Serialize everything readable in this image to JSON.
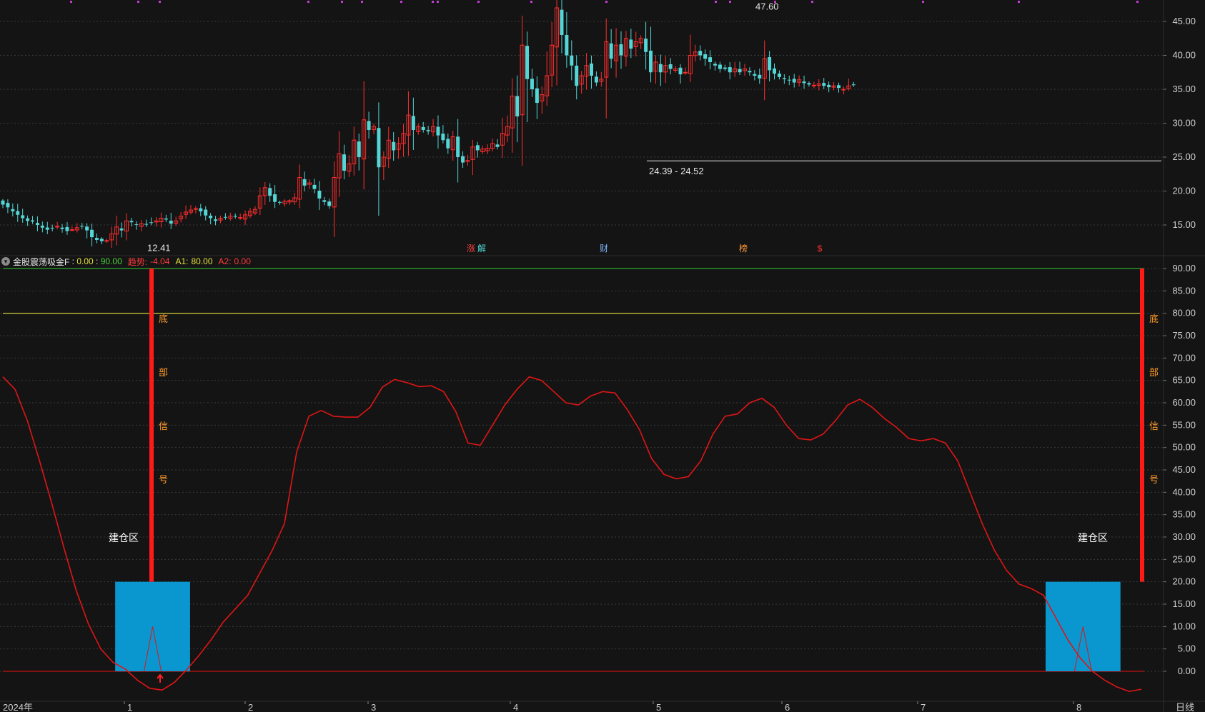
{
  "indicator": {
    "name": "金股震荡吸金F",
    "v0": "0.00",
    "v1": "90.00",
    "trend_label": "趋势:",
    "trend_value": "-4.04",
    "a1_label": "A1:",
    "a1_value": "80.00",
    "a2_label": "A2:",
    "a2_value": "0.00"
  },
  "colors": {
    "bg": "#141414",
    "up": "#ff2d2d",
    "down": "#54d6d6",
    "osc": "#e01515",
    "zone": "#0a97cf",
    "line90": "#2ea82e",
    "line80": "#e6e23c",
    "zero": "#c01010",
    "grid": "#3a3a3a",
    "axis": "#d0d0d0"
  },
  "events": [
    {
      "label": "涨",
      "color": "#ff4040"
    },
    {
      "label": "解",
      "color": "#54d6d6"
    },
    {
      "label": "财",
      "color": "#7fb6ff"
    },
    {
      "label": "榜",
      "color": "#ff9a3a"
    },
    {
      "label": "$",
      "color": "#ff3030"
    }
  ],
  "chart_data": [
    {
      "type": "candlestick",
      "y_ticks": [
        "45.00",
        "40.00",
        "35.00",
        "30.00",
        "25.00",
        "20.00",
        "15.00"
      ],
      "ylim": [
        11.5,
        48.5
      ],
      "annotations": {
        "high": {
          "text": "47.60",
          "value": 47.6
        },
        "low": {
          "text": "12.41",
          "value": 12.41
        },
        "range": {
          "text": "24.39 - 24.52",
          "value": 24.45
        }
      },
      "period": "日线",
      "x_ticks": [
        "2024年",
        "1",
        "2",
        "3",
        "4",
        "5",
        "6",
        "7",
        "8"
      ],
      "close": [
        18.0,
        17.6,
        17.0,
        16.5,
        16.0,
        15.6,
        15.5,
        15.0,
        14.6,
        14.3,
        14.5,
        14.8,
        14.4,
        14.1,
        14.3,
        14.6,
        14.8,
        14.2,
        13.2,
        12.8,
        12.6,
        12.7,
        13.7,
        14.7,
        14.2,
        15.6,
        15.4,
        15.0,
        15.2,
        15.1,
        15.3,
        15.6,
        16.0,
        15.8,
        15.2,
        15.6,
        16.3,
        16.9,
        17.2,
        17.4,
        17.0,
        16.4,
        16.0,
        15.6,
        16.0,
        16.1,
        16.3,
        16.2,
        16.1,
        16.5,
        17.0,
        17.3,
        19.3,
        20.5,
        19.3,
        18.4,
        18.3,
        18.5,
        18.6,
        19.0,
        22.0,
        20.8,
        21.2,
        20.3,
        18.9,
        18.4,
        17.8,
        22.0,
        25.5,
        23.0,
        24.0,
        27.5,
        25.0,
        30.5,
        29.0,
        29.5,
        23.5,
        25.0,
        27.5,
        26.0,
        27.0,
        28.5,
        31.2,
        29.0,
        29.5,
        29.0,
        28.8,
        29.5,
        28.2,
        27.5,
        26.3,
        28.0,
        25.0,
        24.2,
        24.5,
        26.5,
        26.0,
        26.2,
        26.3,
        27.0,
        26.5,
        28.5,
        29.5,
        34.0,
        31.0,
        41.5,
        36.5,
        35.0,
        33.0,
        34.2,
        37.0,
        41.5,
        47.0,
        43.0,
        40.0,
        38.5,
        35.5,
        37.0,
        38.5,
        37.0,
        36.0,
        36.5,
        42.0,
        39.5,
        41.5,
        40.0,
        42.5,
        41.0,
        42.0,
        42.5,
        40.5,
        37.5,
        39.0,
        37.5,
        38.5,
        38.0,
        38.0,
        37.2,
        37.5,
        40.0,
        40.5,
        40.0,
        39.5,
        39.0,
        38.5,
        38.0,
        38.0,
        37.5,
        38.0,
        37.5,
        38.0,
        37.5,
        37.0,
        36.6,
        39.5,
        37.8,
        37.3,
        36.8,
        36.5,
        36.3,
        36.0,
        36.4,
        35.9,
        35.7,
        35.6,
        35.8,
        35.5,
        35.3,
        35.5,
        35.2,
        35.0,
        35.5,
        35.6
      ]
    },
    {
      "type": "line",
      "name": "金股震荡吸金F",
      "y_ticks": [
        "90.00",
        "85.00",
        "80.00",
        "75.00",
        "70.00",
        "65.00",
        "60.00",
        "55.00",
        "50.00",
        "45.00",
        "40.00",
        "35.00",
        "30.00",
        "25.00",
        "20.00",
        "15.00",
        "10.00",
        "5.00",
        "0.00"
      ],
      "ylim": [
        -4.5,
        90
      ],
      "reference_lines": [
        90,
        80,
        0
      ],
      "zone_label": "建仓区",
      "signal_chars": [
        "底",
        "部",
        "信",
        "号"
      ],
      "trend": "-4.04",
      "values": [
        65.8,
        63.0,
        56.0,
        47.0,
        37.5,
        27.5,
        18.0,
        10.5,
        5.0,
        2.0,
        0.5,
        -2.0,
        -3.8,
        -4.2,
        -2.5,
        0.3,
        3.5,
        7.0,
        11.0,
        14.0,
        17.0,
        22.0,
        27.0,
        33.0,
        49.0,
        57.0,
        58.3,
        57.0,
        56.8,
        56.8,
        59.0,
        63.5,
        65.2,
        64.5,
        63.6,
        63.8,
        62.5,
        58.0,
        51.0,
        50.5,
        55.0,
        59.5,
        63.0,
        65.8,
        65.0,
        62.5,
        60.0,
        59.5,
        61.5,
        62.5,
        62.2,
        58.5,
        54.0,
        47.5,
        44.0,
        43.0,
        43.5,
        47.0,
        53.0,
        57.0,
        57.5,
        60.0,
        61.0,
        59.0,
        55.0,
        52.0,
        51.7,
        53.0,
        56.0,
        59.5,
        60.8,
        59.0,
        56.5,
        54.5,
        52.0,
        51.5,
        52.0,
        51.0,
        47.0,
        40.0,
        33.0,
        27.0,
        22.5,
        19.5,
        18.5,
        17.0,
        12.0,
        7.0,
        3.0,
        0.0,
        -2.0,
        -3.5,
        -4.5,
        -4.0
      ],
      "zones": [
        {
          "start": 9,
          "end": 15,
          "top": 20,
          "spike": 10
        },
        {
          "start": 85,
          "end": 91,
          "top": 20,
          "spike": 10
        }
      ],
      "signals": [
        12,
        92
      ]
    }
  ]
}
